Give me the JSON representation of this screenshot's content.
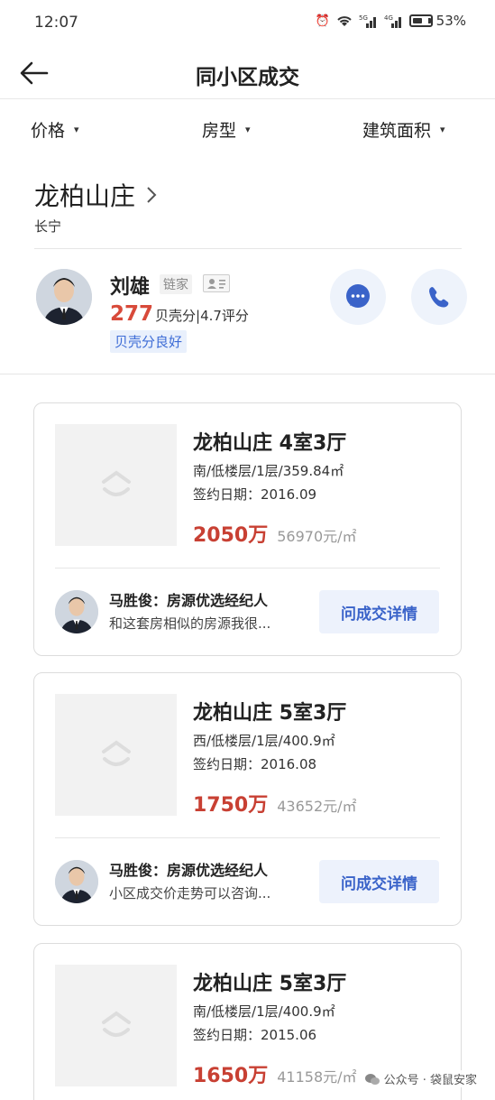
{
  "status": {
    "time": "12:07",
    "battery": "53%"
  },
  "nav": {
    "title": "同小区成交"
  },
  "filters": [
    {
      "label": "价格"
    },
    {
      "label": "房型"
    },
    {
      "label": "建筑面积"
    }
  ],
  "community": {
    "name": "龙柏山庄",
    "district": "长宁"
  },
  "agent": {
    "name": "刘雄",
    "company": "链家",
    "score": "277",
    "score_text": "贝壳分|4.7评分",
    "badge": "贝壳分良好"
  },
  "deals": [
    {
      "title": "龙柏山庄 4室3厅",
      "spec": "南/低楼层/1层/359.84㎡",
      "date": "签约日期：2016.09",
      "total": "2050万",
      "unit_price": "56970元/㎡",
      "agent_name": "马胜俊：房源优选经纪人",
      "agent_msg": "和这套房相似的房源我很...",
      "button": "问成交详情"
    },
    {
      "title": "龙柏山庄 5室3厅",
      "spec": "西/低楼层/1层/400.9㎡",
      "date": "签约日期：2016.08",
      "total": "1750万",
      "unit_price": "43652元/㎡",
      "agent_name": "马胜俊：房源优选经纪人",
      "agent_msg": "小区成交价走势可以咨询...",
      "button": "问成交详情"
    },
    {
      "title": "龙柏山庄 5室3厅",
      "spec": "南/低楼层/1层/400.9㎡",
      "date": "签约日期：2015.06",
      "total": "1650万",
      "unit_price": "41158元/㎡"
    }
  ],
  "watermark": "公众号 · 袋鼠安家",
  "colors": {
    "price": "#c84033",
    "accent": "#3a63c9",
    "score": "#d84a3a"
  }
}
